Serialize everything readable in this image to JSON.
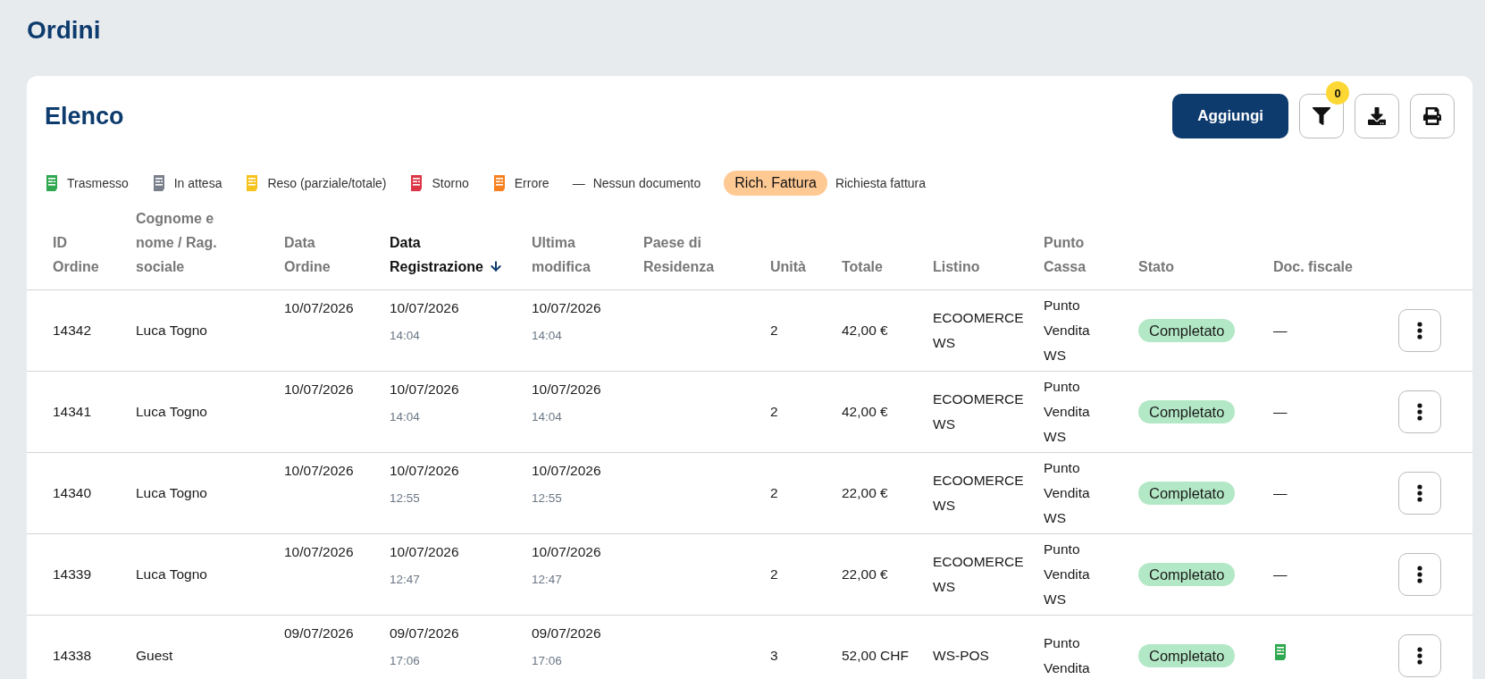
{
  "page_title": "Ordini",
  "card": {
    "title": "Elenco",
    "add_button": "Aggiungi",
    "filter_count": "0"
  },
  "legend": [
    {
      "kind": "icon",
      "color": "#2fa84f",
      "label": "Trasmesso"
    },
    {
      "kind": "icon",
      "color": "#7a7f8c",
      "label": "In attesa"
    },
    {
      "kind": "icon",
      "color": "#f6c21c",
      "label": "Reso (parziale/totale)"
    },
    {
      "kind": "icon",
      "color": "#dc3545",
      "label": "Storno"
    },
    {
      "kind": "icon",
      "color": "#f7811e",
      "label": "Errore"
    },
    {
      "kind": "dash",
      "symbol": "—",
      "label": "Nessun documento"
    },
    {
      "kind": "badge",
      "badge": "Rich. Fattura",
      "label": "Richiesta fattura"
    }
  ],
  "columns": [
    {
      "label": "ID Ordine",
      "sorted": false
    },
    {
      "label": "Cognome e nome / Rag. sociale",
      "sorted": false
    },
    {
      "label": "Data Ordine",
      "sorted": false
    },
    {
      "label": "Data Registrazione",
      "sorted": true
    },
    {
      "label": "Ultima modifica",
      "sorted": false
    },
    {
      "label": "Paese di Residenza",
      "sorted": false
    },
    {
      "label": "Unità",
      "sorted": false
    },
    {
      "label": "Totale",
      "sorted": false
    },
    {
      "label": "Listino",
      "sorted": false
    },
    {
      "label": "Punto Cassa",
      "sorted": false
    },
    {
      "label": "Stato",
      "sorted": false
    },
    {
      "label": "Doc. fiscale",
      "sorted": false
    }
  ],
  "rows": [
    {
      "id": "14342",
      "name": "Luca Togno",
      "order_date": "10/07/2026",
      "reg_date": "10/07/2026",
      "reg_time": "14:04",
      "mod_date": "10/07/2026",
      "mod_time": "14:04",
      "units": "2",
      "total": "42,00 €",
      "listino": "ECOOMERCE WS",
      "punto_cassa": "Punto Vendita WS",
      "status": "Completato",
      "doc": {
        "kind": "text",
        "text": "—"
      }
    },
    {
      "id": "14341",
      "name": "Luca Togno",
      "order_date": "10/07/2026",
      "reg_date": "10/07/2026",
      "reg_time": "14:04",
      "mod_date": "10/07/2026",
      "mod_time": "14:04",
      "units": "2",
      "total": "42,00 €",
      "listino": "ECOOMERCE WS",
      "punto_cassa": "Punto Vendita WS",
      "status": "Completato",
      "doc": {
        "kind": "text",
        "text": "—"
      }
    },
    {
      "id": "14340",
      "name": "Luca Togno",
      "order_date": "10/07/2026",
      "reg_date": "10/07/2026",
      "reg_time": "12:55",
      "mod_date": "10/07/2026",
      "mod_time": "12:55",
      "units": "2",
      "total": "22,00 €",
      "listino": "ECOOMERCE WS",
      "punto_cassa": "Punto Vendita WS",
      "status": "Completato",
      "doc": {
        "kind": "text",
        "text": "—"
      }
    },
    {
      "id": "14339",
      "name": "Luca Togno",
      "order_date": "10/07/2026",
      "reg_date": "10/07/2026",
      "reg_time": "12:47",
      "mod_date": "10/07/2026",
      "mod_time": "12:47",
      "units": "2",
      "total": "22,00 €",
      "listino": "ECOOMERCE WS",
      "punto_cassa": "Punto Vendita WS",
      "status": "Completato",
      "doc": {
        "kind": "text",
        "text": "—"
      }
    },
    {
      "id": "14338",
      "name": "Guest",
      "order_date": "09/07/2026",
      "reg_date": "09/07/2026",
      "reg_time": "17:06",
      "mod_date": "09/07/2026",
      "mod_time": "17:06",
      "units": "3",
      "total": "52,00 CHF",
      "listino": "WS-POS",
      "punto_cassa": "Punto Vendita",
      "status": "Completato",
      "doc": {
        "kind": "icon",
        "color": "#2fa84f"
      }
    }
  ]
}
